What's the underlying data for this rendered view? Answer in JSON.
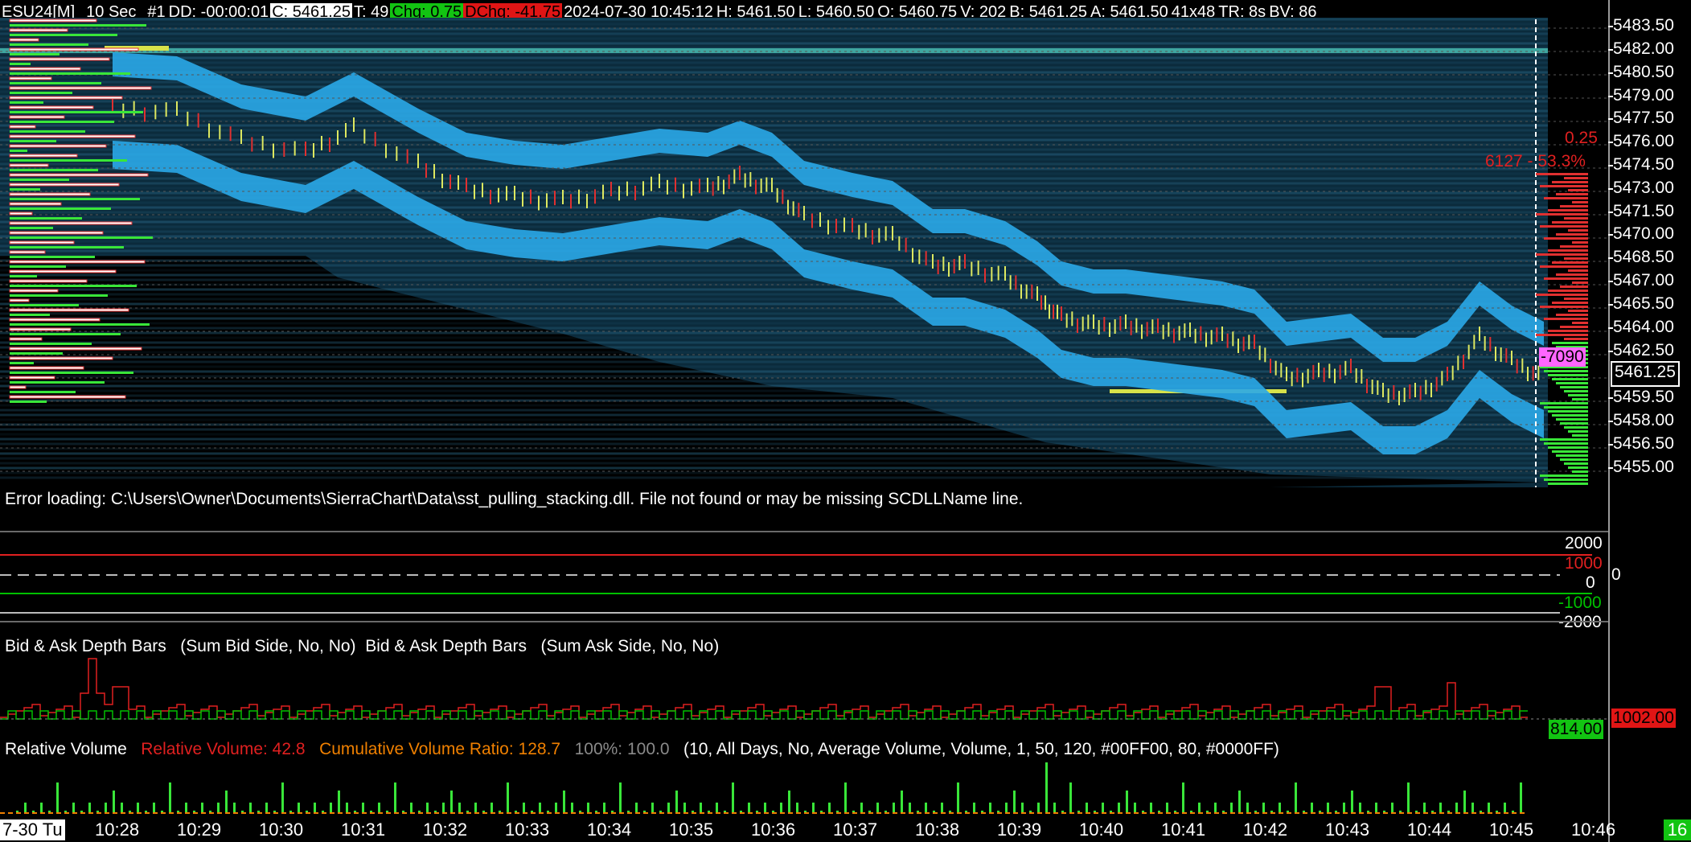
{
  "header": {
    "symbol": "ESU24[M]",
    "timeframe": "10 Sec",
    "chart_num": "#1",
    "dd": "DD: -00:00:01",
    "close": "C: 5461.25",
    "trades": "T: 49",
    "chg": "Chg: 0.75",
    "dchg": "DChg: -41.75",
    "datetime": "2024-07-30 10:45:12",
    "high": "H: 5461.50",
    "low": "L: 5460.50",
    "open": "O: 5460.75",
    "volume": "V: 202",
    "bid": "B: 5461.25",
    "ask": "A: 5461.50",
    "size": "41x48",
    "timer": "TR: 8s",
    "bv": "BV: 86"
  },
  "price_axis": {
    "labels": [
      "5483.50",
      "5482.00",
      "5480.50",
      "5479.00",
      "5477.50",
      "5476.00",
      "5474.50",
      "5473.00",
      "5471.50",
      "5470.00",
      "5468.50",
      "5467.00",
      "5465.50",
      "5464.00",
      "5462.50",
      "5461.25",
      "5459.50",
      "5458.00",
      "5456.50",
      "5455.00"
    ],
    "current_price": "5461.25"
  },
  "annotations": {
    "tick_size": "0.25",
    "ratio_text": "6127 - 53.3%",
    "delta_badge": "-7090",
    "error_message": "Error loading: C:\\Users\\Owner\\Documents\\SierraChart\\Data\\sst_pulling_stacking.dll. File not found or may be missing SCDLLName line."
  },
  "pane2": {
    "axis_labels": [
      "2000",
      "1000",
      "0",
      "-1000",
      "-2000"
    ],
    "zero_right": "0"
  },
  "pane3": {
    "study_bid": "Bid & Ask Depth Bars",
    "study_bid_params": "(Sum Bid Side, No, No)",
    "study_ask": "Bid & Ask Depth Bars",
    "study_ask_params": "(Sum Ask Side, No, No)",
    "bid_value": "814.00",
    "ask_value": "1002.00"
  },
  "pane4": {
    "study_name": "Relative Volume",
    "rel_vol": "Relative Volume: 42.8",
    "cum_ratio": "Cumulative Volume Ratio: 128.7",
    "pct100": "100%: 100.0",
    "params": "(10, All Days, No, Average Volume, Volume, 1, 50, 120, #00FF00, 80, #0000FF)"
  },
  "time_axis": {
    "date_label": "7-30 Tu",
    "labels": [
      "10:28",
      "10:29",
      "10:30",
      "10:31",
      "10:32",
      "10:33",
      "10:34",
      "10:35",
      "10:36",
      "10:37",
      "10:38",
      "10:39",
      "10:40",
      "10:41",
      "10:42",
      "10:43",
      "10:44",
      "10:45",
      "10:46"
    ],
    "counter": "16"
  },
  "colors": {
    "background": "#000000",
    "heat_low": "#0b2b3c",
    "heat_mid": "#1f7fb8",
    "heat_high": "#2aa8e8",
    "heat_peak": "#d7e24a",
    "up_bar": "#39e639",
    "down_bar": "#e03030",
    "bid_line": "#00c000",
    "ask_line": "#e02020"
  }
}
